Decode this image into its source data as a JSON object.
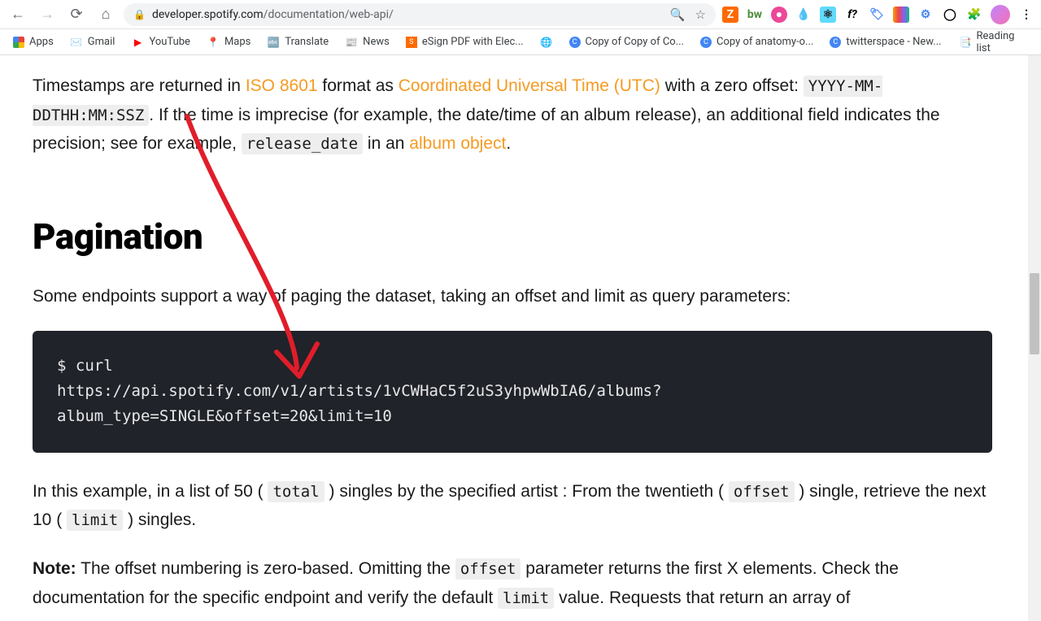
{
  "browser": {
    "url_host": "developer.spotify.com",
    "url_path": "/documentation/web-api/"
  },
  "bookmarks": {
    "apps": "Apps",
    "gmail": "Gmail",
    "youtube": "YouTube",
    "maps": "Maps",
    "translate": "Translate",
    "news": "News",
    "esign": "eSign PDF with Elec...",
    "copy1": "Copy of Copy of Co...",
    "copy2": "Copy of anatomy-o...",
    "twitter": "twitterspace - New...",
    "reading_list": "Reading list"
  },
  "content": {
    "p1_a": "Timestamps are returned in ",
    "p1_link1": "ISO 8601",
    "p1_b": " format as ",
    "p1_link2": "Coordinated Universal Time (UTC)",
    "p1_c": " with a zero offset: ",
    "p1_code1": "YYYY-MM-DDTHH:MM:SSZ",
    "p1_d": ". If the time is imprecise (for example, the date/time of an album release), an additional field indicates the precision; see for example, ",
    "p1_code2": "release_date",
    "p1_e": " in an ",
    "p1_link3": "album object",
    "p1_f": ".",
    "h2": "Pagination",
    "p2": "Some endpoints support a way of paging the dataset, taking an offset and limit as query parameters:",
    "code_line1": "$ curl",
    "code_line2a": "https://api.spotify.com/v1/artists/1vCWHaC5f2uS3yhpwWbIA6/albums?",
    "code_line3a": "album_type",
    "code_eq": "=",
    "code_line3b": "SINGLE&offset",
    "code_line3c": "20&limit",
    "code_line3d": "10",
    "p3_a": "In this example, in a list of 50 ( ",
    "p3_code1": "total",
    "p3_b": " ) singles by the specified artist : From the twentieth ( ",
    "p3_code2": "offset",
    "p3_c": " ) single, retrieve the next 10 ( ",
    "p3_code3": "limit",
    "p3_d": " ) singles.",
    "p4_note": "Note:",
    "p4_a": " The offset numbering is zero-based. Omitting the ",
    "p4_code1": "offset",
    "p4_b": " parameter returns the first X elements. Check the documentation for the specific endpoint and verify the default ",
    "p4_code2": "limit",
    "p4_c": " value. Requests that return an array of"
  }
}
